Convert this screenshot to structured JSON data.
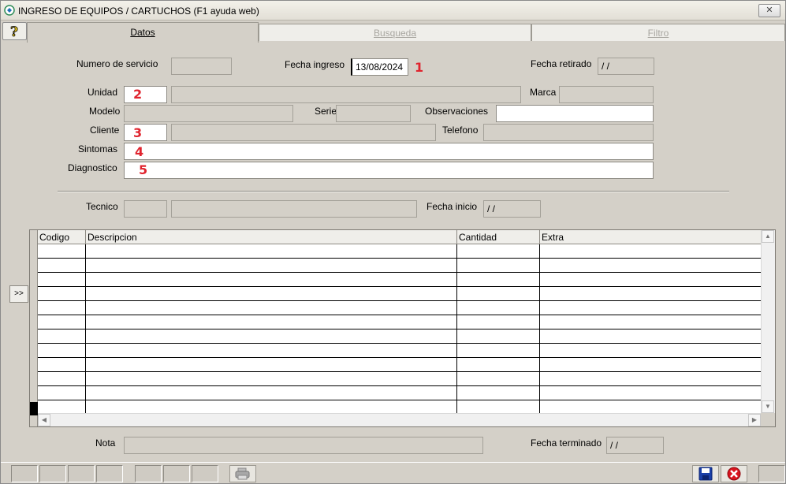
{
  "window": {
    "title": "INGRESO DE EQUIPOS / CARTUCHOS (F1 ayuda web)",
    "close_label": "✕"
  },
  "tabs": [
    {
      "label": "Datos"
    },
    {
      "label": "Busqueda"
    },
    {
      "label": "Filtro"
    }
  ],
  "help_icon": "question-mark",
  "form": {
    "numero_servicio": {
      "label": "Numero de servicio",
      "value": ""
    },
    "fecha_ingreso": {
      "label": "Fecha ingreso",
      "value": "13/08/2024"
    },
    "fecha_retirado": {
      "label": "Fecha retirado",
      "value": " / /"
    },
    "unidad": {
      "label": "Unidad",
      "code": "",
      "value": ""
    },
    "marca": {
      "label": "Marca",
      "value": ""
    },
    "modelo": {
      "label": "Modelo",
      "value": ""
    },
    "serie": {
      "label": "Serie",
      "value": ""
    },
    "observaciones": {
      "label": "Observaciones",
      "value": ""
    },
    "cliente": {
      "label": "Cliente",
      "code": "",
      "value": ""
    },
    "telefono": {
      "label": "Telefono",
      "value": ""
    },
    "sintomas": {
      "label": "Sintomas",
      "value": ""
    },
    "diagnostico": {
      "label": "Diagnostico",
      "value": ""
    },
    "tecnico": {
      "label": "Tecnico",
      "code": "",
      "value": ""
    },
    "fecha_inicio": {
      "label": "Fecha inicio",
      "value": " / /"
    },
    "nota": {
      "label": "Nota",
      "value": ""
    },
    "fecha_terminado": {
      "label": "Fecha terminado",
      "value": " / /"
    }
  },
  "annotations": [
    "1",
    "2",
    "3",
    "4",
    "5"
  ],
  "grid": {
    "columns": [
      "Codigo",
      "Descripcion",
      "Cantidad",
      "Extra"
    ],
    "rows": []
  },
  "arrow_button": ">>",
  "toolbar": {
    "print_icon": "printer-icon",
    "save_icon": "floppy-disk-icon",
    "cancel_icon": "cancel-icon"
  },
  "colors": {
    "annotation": "#e0242e",
    "background": "#d4d0c8"
  }
}
